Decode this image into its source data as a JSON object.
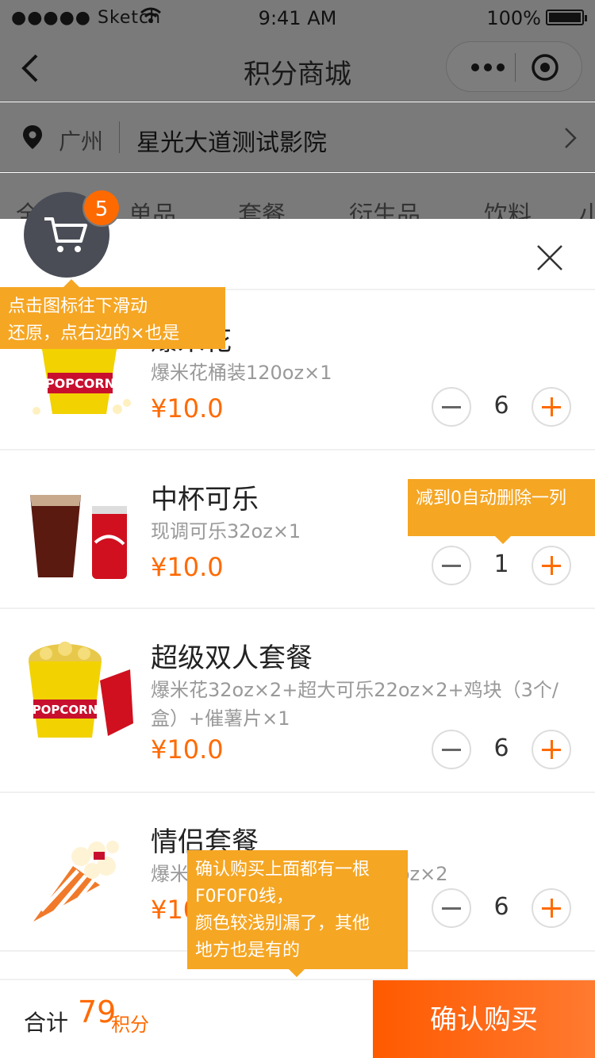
{
  "status_bar": {
    "signal": "●●●●● Sketch",
    "time": "9:41 AM",
    "battery": "100%"
  },
  "nav": {
    "title": "积分商城"
  },
  "location": {
    "city": "广州",
    "cinema": "星光大道测试影院"
  },
  "tabs": [
    "全部",
    "单品",
    "套餐",
    "衍生品",
    "饮料",
    "小"
  ],
  "cart": {
    "count": "5"
  },
  "items": [
    {
      "name": "爆米花",
      "desc": "爆米花桶装120oz×1",
      "price": "¥10.0",
      "qty": "6"
    },
    {
      "name": "中杯可乐",
      "desc": "现调可乐32oz×1",
      "price": "¥10.0",
      "qty": "1"
    },
    {
      "name": "超级双人套餐",
      "desc": "爆米花32oz×2+超大可乐22oz×2+鸡块（3个/盒）+催薯片×1",
      "price": "¥10.0",
      "qty": "6"
    },
    {
      "name": "情侣套餐",
      "desc": "爆米花32oz×2+超大可乐22oz×2",
      "price": "¥10.0",
      "qty": "6"
    }
  ],
  "footer": {
    "total_label": "合计",
    "total_value": "79",
    "total_unit": "积分",
    "confirm_label": "确认购买"
  },
  "notes": {
    "n1_line1": "点击图标往下滑动",
    "n1_line2": "还原，点右边的×也是",
    "n2": "减到0自动删除一列",
    "n3_line1": "确认购买上面都有一根",
    "n3_line2": "F0F0F0线，",
    "n3_line3": "颜色较浅别漏了，其他",
    "n3_line4": "地方也是有的"
  },
  "colors": {
    "accent": "#ff6a00",
    "note": "#f5a623",
    "overlay": "#7a7a7a",
    "divider": "#f0f0f0"
  }
}
